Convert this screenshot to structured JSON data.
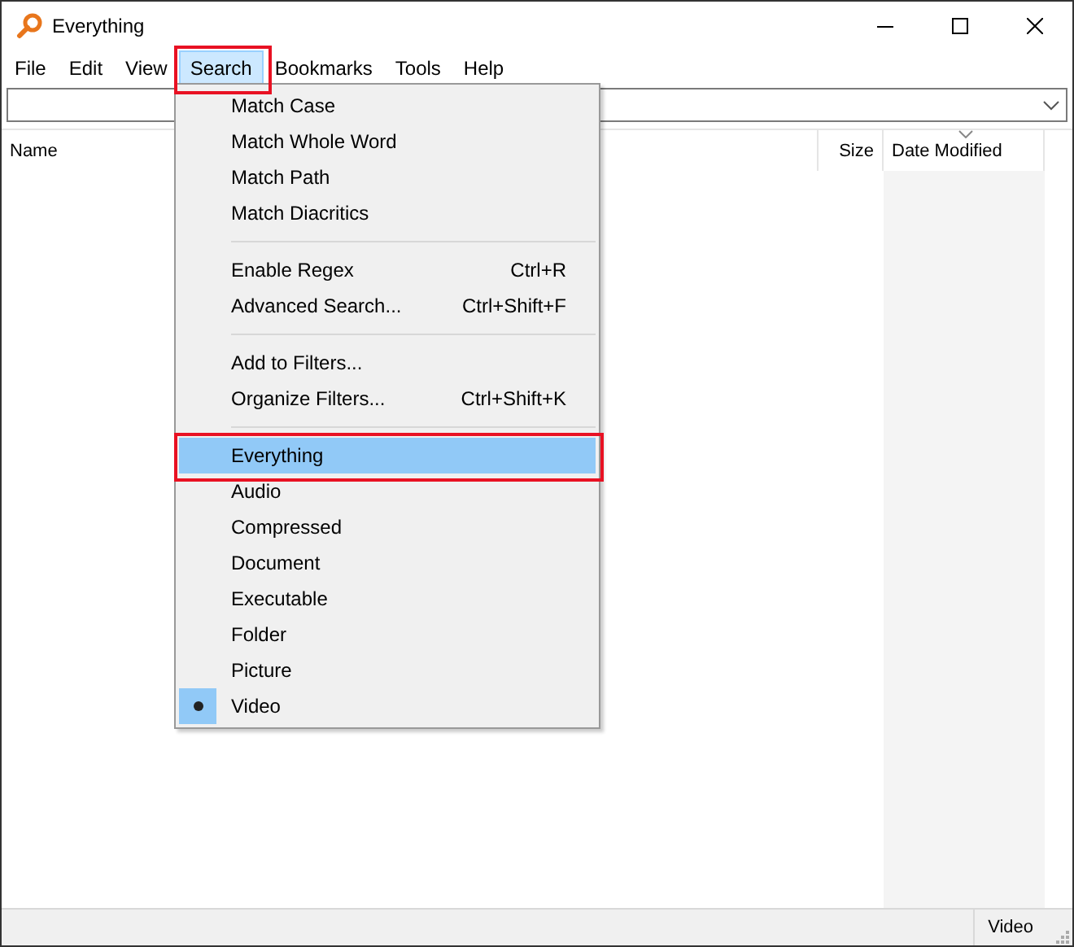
{
  "window": {
    "title": "Everything"
  },
  "menu_bar": [
    {
      "label": "File",
      "selected": false
    },
    {
      "label": "Edit",
      "selected": false
    },
    {
      "label": "View",
      "selected": false
    },
    {
      "label": "Search",
      "selected": true
    },
    {
      "label": "Bookmarks",
      "selected": false
    },
    {
      "label": "Tools",
      "selected": false
    },
    {
      "label": "Help",
      "selected": false
    }
  ],
  "columns": [
    {
      "label": "Name",
      "kind": "name"
    },
    {
      "label": "Size",
      "kind": "size"
    },
    {
      "label": "Date Modified",
      "kind": "sorted"
    }
  ],
  "menu": [
    {
      "kind": "item",
      "label": "Match Case",
      "selected": false,
      "checked": false
    },
    {
      "kind": "item",
      "label": "Match Whole Word",
      "selected": false,
      "checked": false
    },
    {
      "kind": "item",
      "label": "Match Path",
      "selected": false,
      "checked": false
    },
    {
      "kind": "item",
      "label": "Match Diacritics",
      "selected": false,
      "checked": false
    },
    {
      "kind": "separator"
    },
    {
      "kind": "item",
      "label": "Enable Regex",
      "shortcut": "Ctrl+R",
      "selected": false,
      "checked": false
    },
    {
      "kind": "item",
      "label": "Advanced Search...",
      "shortcut": "Ctrl+Shift+F",
      "selected": false,
      "checked": false
    },
    {
      "kind": "separator"
    },
    {
      "kind": "item",
      "label": "Add to Filters...",
      "selected": false,
      "checked": false
    },
    {
      "kind": "item",
      "label": "Organize Filters...",
      "shortcut": "Ctrl+Shift+K",
      "selected": false,
      "checked": false
    },
    {
      "kind": "separator"
    },
    {
      "kind": "item",
      "label": "Everything",
      "selected": true,
      "checked": false
    },
    {
      "kind": "item",
      "label": "Audio",
      "selected": false,
      "checked": false
    },
    {
      "kind": "item",
      "label": "Compressed",
      "selected": false,
      "checked": false
    },
    {
      "kind": "item",
      "label": "Document",
      "selected": false,
      "checked": false
    },
    {
      "kind": "item",
      "label": "Executable",
      "selected": false,
      "checked": false
    },
    {
      "kind": "item",
      "label": "Folder",
      "selected": false,
      "checked": false
    },
    {
      "kind": "item",
      "label": "Picture",
      "selected": false,
      "checked": false
    },
    {
      "kind": "item",
      "label": "Video",
      "selected": false,
      "checked": true
    }
  ],
  "status_bar": {
    "filter": "Video"
  }
}
